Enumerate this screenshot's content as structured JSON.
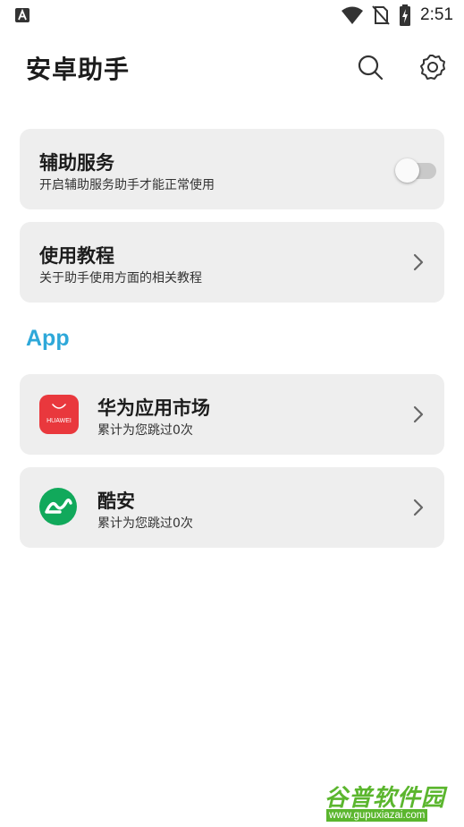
{
  "status_bar": {
    "left_icon": "accessibility-a-icon",
    "time": "2:51",
    "icons": [
      "wifi-icon",
      "no-sim-icon",
      "battery-charging-icon"
    ]
  },
  "header": {
    "title": "安卓助手",
    "actions": [
      "search-icon",
      "gear-icon"
    ]
  },
  "cards": {
    "accessibility": {
      "title": "辅助服务",
      "subtitle": "开启辅助服务助手才能正常使用",
      "enabled": false
    },
    "tutorial": {
      "title": "使用教程",
      "subtitle": "关于助手使用方面的相关教程"
    }
  },
  "section": {
    "title": "App"
  },
  "apps": [
    {
      "name": "华为应用市场",
      "subtitle": "累计为您跳过0次",
      "icon": "huawei-appgallery-icon",
      "icon_text": "HUAWEI",
      "color": "#e9383d"
    },
    {
      "name": "酷安",
      "subtitle": "累计为您跳过0次",
      "icon": "coolapk-icon",
      "color": "#11a95b"
    }
  ],
  "watermark": {
    "title": "谷普软件园",
    "url": "www.gupuxiazai.com"
  },
  "colors": {
    "accent": "#2ea8d9",
    "card_bg": "#eeeeee"
  }
}
